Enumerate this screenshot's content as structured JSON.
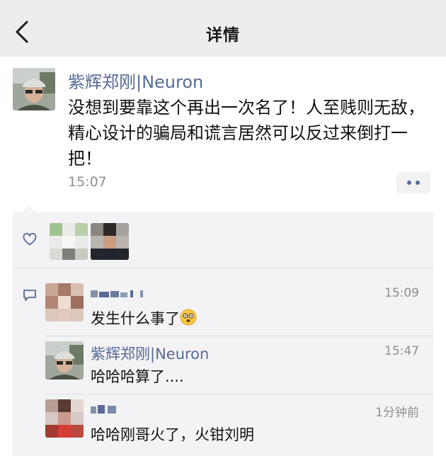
{
  "header": {
    "title": "详情",
    "back_icon": "chevron-left-icon"
  },
  "post": {
    "author": "紫辉郑刚|Neuron",
    "content": "没想到要靠这个再出一次名了！人至贱则无敌，精心设计的骗局和谎言居然可以反过来倒打一把！",
    "time": "15:07",
    "more_icon": "more-dots-icon"
  },
  "likes": {
    "icon": "heart-outline-icon",
    "avatars": [
      "liker-avatar-1",
      "liker-avatar-2"
    ]
  },
  "comments": [
    {
      "name": "",
      "time": "15:09",
      "text": "发生什么事了",
      "emoji": "dizzy-face-emoji"
    },
    {
      "name": "紫辉郑刚|Neuron",
      "time": "15:47",
      "text": "哈哈哈算了...."
    },
    {
      "name": "",
      "time": "1分钟前",
      "text": "哈哈刚哥火了，火钳刘明"
    }
  ],
  "colors": {
    "link_blue": "#576b95",
    "top_bar": "#ededed",
    "comment_bg": "#f3f3f5",
    "timestamp": "#8f8f8f"
  }
}
